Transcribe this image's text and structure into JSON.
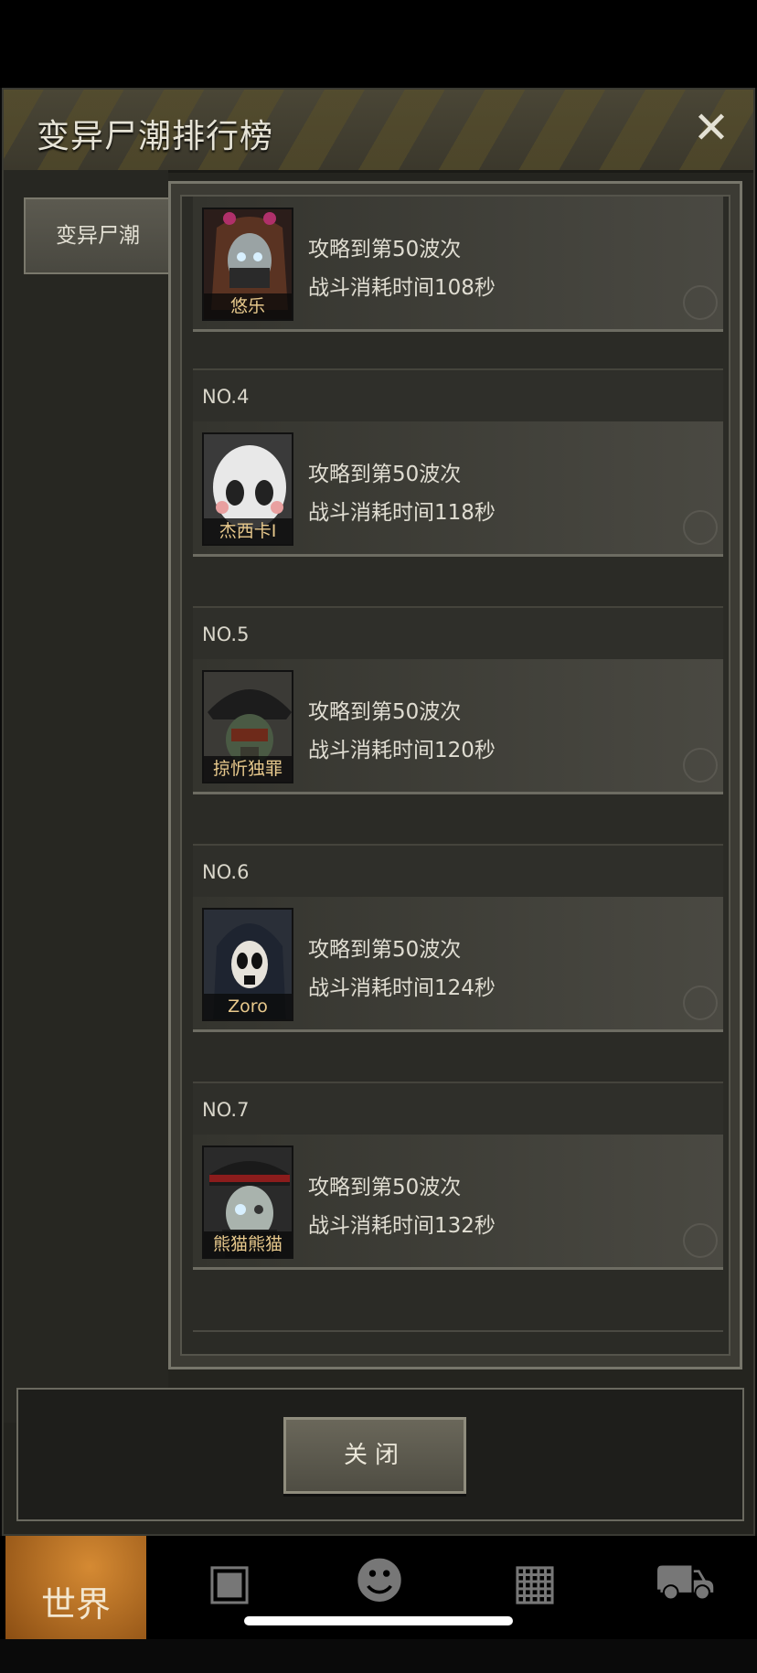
{
  "header": {
    "title": "变异尸潮排行榜"
  },
  "sidebar": {
    "category_tab": "变异尸潮"
  },
  "entries": [
    {
      "rank": "",
      "player": "悠乐",
      "line1": "攻略到第50波次",
      "line2": "战斗消耗时间108秒"
    },
    {
      "rank": "NO.4",
      "player": "杰西卡I",
      "line1": "攻略到第50波次",
      "line2": "战斗消耗时间118秒"
    },
    {
      "rank": "NO.5",
      "player": "掠忻独罪",
      "line1": "攻略到第50波次",
      "line2": "战斗消耗时间120秒"
    },
    {
      "rank": "NO.6",
      "player": "Zoro",
      "line1": "攻略到第50波次",
      "line2": "战斗消耗时间124秒"
    },
    {
      "rank": "NO.7",
      "player": "熊猫熊猫",
      "line1": "攻略到第50波次",
      "line2": "战斗消耗时间132秒"
    }
  ],
  "footer": {
    "close_label": "关闭"
  },
  "nav": {
    "world_label": "世界"
  },
  "icons": {
    "close": "close-icon",
    "bag": "backpack-icon",
    "skills": "head-gear-icon",
    "building": "building-icon",
    "shop": "cart-icon"
  }
}
